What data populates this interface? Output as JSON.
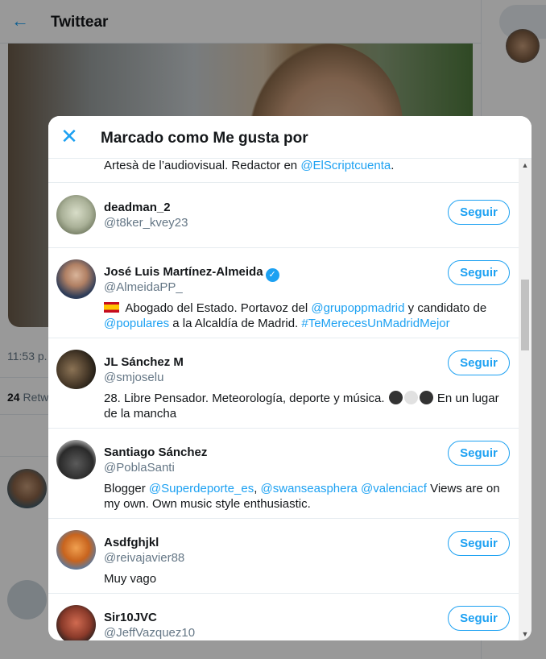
{
  "background": {
    "title": "Twittear",
    "time_partial": "11:53 p.",
    "retweets_count": "24",
    "retweets_label": "Retw"
  },
  "modal": {
    "title": "Marcado como Me gusta por",
    "top_partial_bio_prefix": "Artesà de l’audiovisual. Redactor en ",
    "top_partial_bio_link": "@ElScriptcuenta",
    "top_partial_bio_suffix": ".",
    "follow_label": "Seguir",
    "users": [
      {
        "name": "deadman_2",
        "handle": "@t8ker_kvey23"
      },
      {
        "name": "José Luis Martínez-Almeida",
        "handle": "@AlmeidaPP_",
        "verified": true,
        "bio": {
          "t1": "Abogado del Estado. Portavoz del ",
          "l1": "@grupoppmadrid",
          "t2": " y candidato de ",
          "l2": "@populares",
          "t3": " a la Alcaldía de Madrid. ",
          "l3": "#TeMerecesUnMadridMejor"
        }
      },
      {
        "name": "JL Sánchez M",
        "handle": "@smjoselu",
        "bio": {
          "t1": "28. Libre Pensador. Meteorología, deporte y música. ",
          "t2": " En un lugar de la mancha"
        }
      },
      {
        "name": "Santiago Sánchez",
        "handle": "@PoblaSanti",
        "bio": {
          "t1": "Blogger ",
          "l1": "@Superdeporte_es",
          "t2": ", ",
          "l2": "@swanseasphera",
          "t3": " ",
          "l3": "@valenciacf",
          "t4": " Views are on my own. Own music style enthusiastic."
        }
      },
      {
        "name": "Asdfghjkl",
        "handle": "@reivajavier88",
        "bio": {
          "t1": "Muy vago"
        }
      },
      {
        "name": "Sir10JVC",
        "handle": "@JeffVazquez10"
      }
    ]
  },
  "colors": {
    "accent": "#1da1f2",
    "secondary_text": "#657786",
    "border": "#e6ecf0"
  },
  "icons": {
    "back": "arrow-left-icon",
    "close": "close-icon",
    "verified": "verified-badge-icon",
    "flag": "spain-flag-icon"
  }
}
